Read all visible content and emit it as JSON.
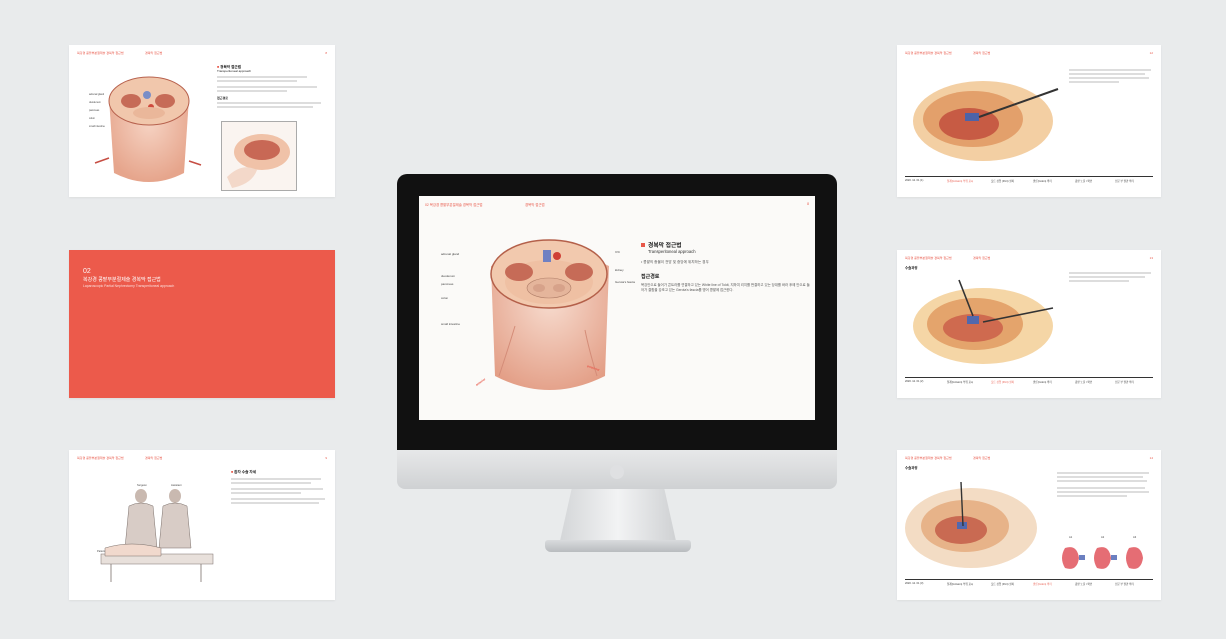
{
  "slides": {
    "left_top": {
      "header": "복강경 콩팥부분절제술 경복막 접근법",
      "section": "경복막 접근법",
      "page": "8",
      "heading": "경복막 접근법",
      "heading_en": "Transperitoneal approach",
      "sub_heading": "접근경로",
      "labels": [
        "adrenal gland",
        "duodenum",
        "pancreas",
        "colon",
        "small intestine"
      ]
    },
    "left_mid": {
      "number": "02",
      "title": "복강경 콩팥부분절제술 경복막 접근법",
      "subtitle": "Laparoscopic Partial Nephrectomy Transperitoneal approach"
    },
    "left_bottom": {
      "header": "복강경 콩팥부분절제술 경복막 접근법",
      "section": "경복막 접근법",
      "page": "9",
      "heading": "환자 수술 자세",
      "labels": [
        "Surgeon",
        "Assistant",
        "Patient"
      ]
    },
    "right_top": {
      "header": "복강경 콩팥부분절제술 경복막 접근법",
      "section": "경복막 접근법",
      "page": "12",
      "timeline": [
        "2020. 12. 01 (1)",
        "절개(Incision) 부위 표시",
        "포트 삽입 (Port) 설치",
        "콜론(Colon) 박리",
        "콩팥 노출 / 확인",
        "신문 부 혈관 박리"
      ]
    },
    "right_mid": {
      "header": "복강경 콩팥부분절제술 경복막 접근법",
      "section": "경복막 접근법",
      "page": "13",
      "heading": "수술과정",
      "timeline": [
        "2020. 12. 01 (2)",
        "절개(Incision) 부위 표시",
        "포트 삽입 (Port) 설치",
        "콜론(Colon) 박리",
        "콩팥 노출 / 확인",
        "신문 부 혈관 박리"
      ]
    },
    "right_bottom": {
      "header": "복강경 콩팥부분절제술 경복막 접근법",
      "section": "경복막 접근법",
      "page": "14",
      "heading": "수술과정",
      "kidney_labels": [
        "A1",
        "A2",
        "A3"
      ],
      "timeline": [
        "2020. 12. 01 (3)",
        "절개(Incision) 부위 표시",
        "포트 삽입 (Port) 설치",
        "콜론(Colon) 박리",
        "콩팥 노출 / 확인",
        "신문 부 혈관 박리"
      ]
    }
  },
  "monitor": {
    "header": "02 복강경 콩팥부분절제술 경복막 접근법",
    "section": "경복막 접근법",
    "page": "8",
    "heading": "경복막 접근법",
    "heading_en": "Transperitoneal approach",
    "bullet": "• 콩팥의 종물이 전방 및 중앙에 위치하는 경우",
    "sub_heading": "접근경로",
    "paragraph": "복강안으로 들어가 콘트라를 연결하고 있는 White line of Toldt, 지하여 리지를 떤결하고 있는 당대를 바라 후에 안으로 들어가 결합을 강조고 있는 Gerota's fascia를 명어 콩팥에 접근한다.",
    "labels": {
      "adrenal_gland": "adrenal gland",
      "duodenum": "duodenum",
      "pancreas": "pancreas",
      "colon": "colon",
      "small_intestine": "small intestine",
      "ivc": "IVC",
      "kidney": "kidney",
      "gerota": "Gerota's fascia",
      "anterior": "anterior",
      "posterior": "posterior"
    }
  },
  "colors": {
    "accent": "#e8584a",
    "background": "#e9ebec"
  }
}
